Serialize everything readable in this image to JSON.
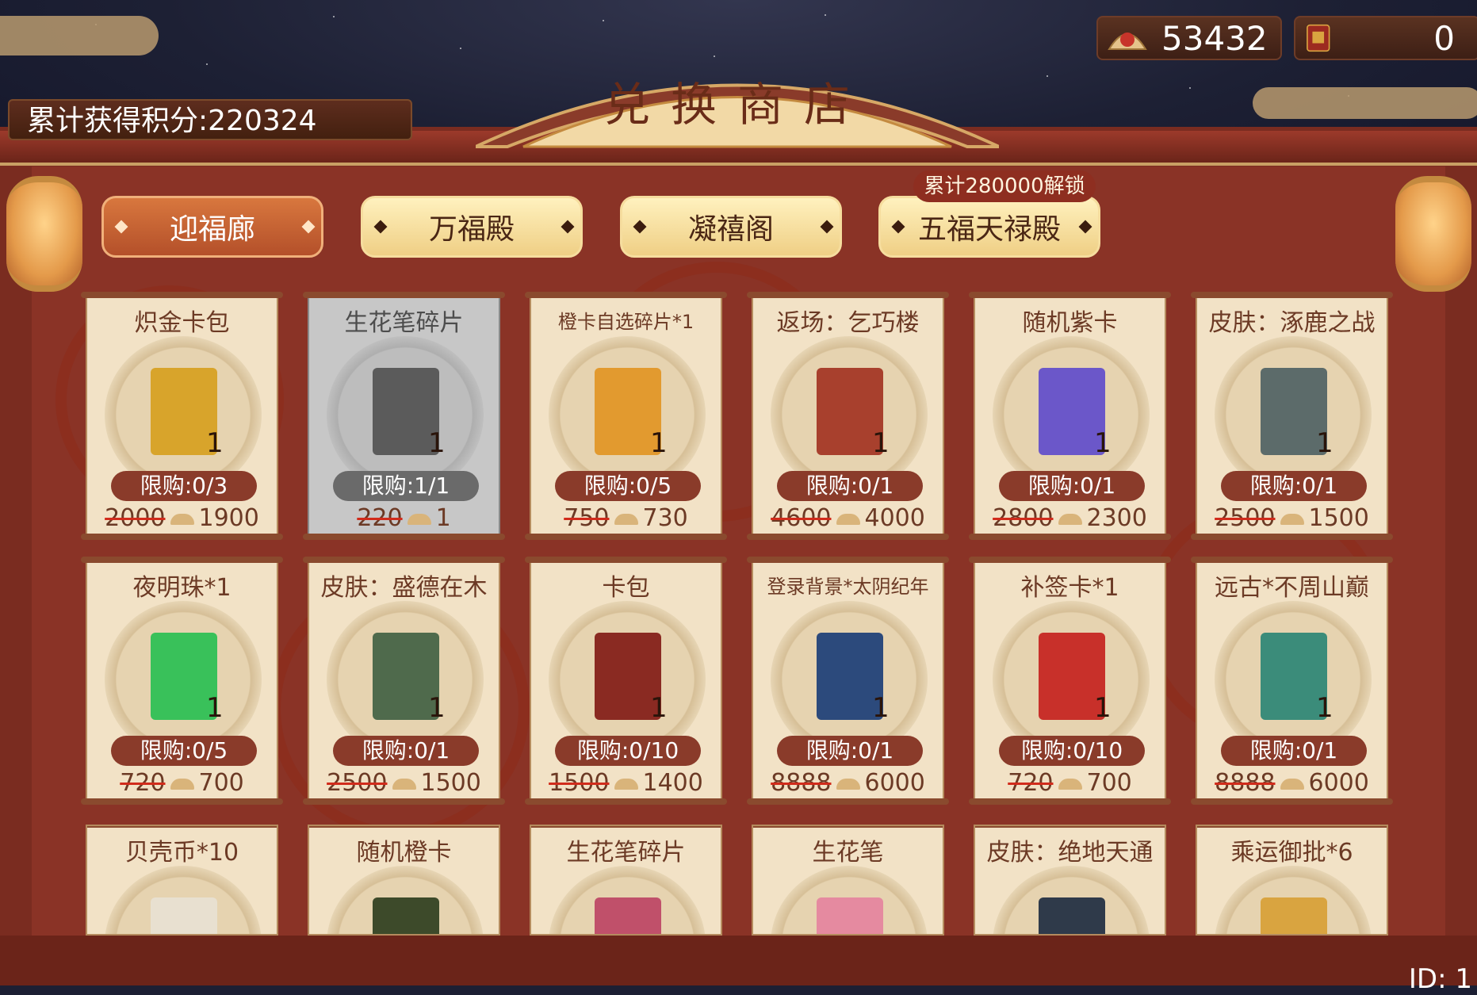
{
  "currency": {
    "points_icon": "points-coin-icon",
    "points": "53432",
    "exchange_icon": "exchange-token-icon",
    "tokens": "0"
  },
  "header": {
    "total_score": "累计获得积分:220324",
    "shop_title": "兑换商店"
  },
  "tabs": [
    {
      "label": "迎福廊",
      "active": true
    },
    {
      "label": "万福殿",
      "active": false
    },
    {
      "label": "凝禧阁",
      "active": false
    },
    {
      "label": "五福天禄殿",
      "active": false
    }
  ],
  "unlock_badge": "累计280000解锁",
  "items": [
    {
      "name": "炽金卡包",
      "qty": "1",
      "limit": "限购:0/3",
      "old_price": "2000",
      "price": "1900",
      "sold_out": false,
      "icon": "gold-card-pack-icon",
      "color": "#d8a42b"
    },
    {
      "name": "生花笔碎片",
      "qty": "1",
      "limit": "限购:1/1",
      "old_price": "220",
      "price": "1",
      "sold_out": true,
      "icon": "brush-fragment-icon",
      "color": "#5b5b5b"
    },
    {
      "name": "橙卡自选碎片*1",
      "qty": "1",
      "limit": "限购:0/5",
      "old_price": "750",
      "price": "730",
      "sold_out": false,
      "icon": "orange-fragment-icon",
      "color": "#e29a2f"
    },
    {
      "name": "返场：乞巧楼",
      "qty": "1",
      "limit": "限购:0/1",
      "old_price": "4600",
      "price": "4000",
      "sold_out": false,
      "icon": "qiqiao-tower-icon",
      "color": "#a8402d"
    },
    {
      "name": "随机紫卡",
      "qty": "1",
      "limit": "限购:0/1",
      "old_price": "2800",
      "price": "2300",
      "sold_out": false,
      "icon": "purple-card-icon",
      "color": "#6b57c9"
    },
    {
      "name": "皮肤：涿鹿之战",
      "qty": "1",
      "limit": "限购:0/1",
      "old_price": "2500",
      "price": "1500",
      "sold_out": false,
      "icon": "skin-zhuolu-icon",
      "color": "#5c6b6a"
    },
    {
      "name": "夜明珠*1",
      "qty": "1",
      "limit": "限购:0/5",
      "old_price": "720",
      "price": "700",
      "sold_out": false,
      "icon": "night-pearl-icon",
      "color": "#39c15a"
    },
    {
      "name": "皮肤：盛德在木",
      "qty": "1",
      "limit": "限购:0/1",
      "old_price": "2500",
      "price": "1500",
      "sold_out": false,
      "icon": "skin-shengde-icon",
      "color": "#4f6a4c"
    },
    {
      "name": "卡包",
      "qty": "1",
      "limit": "限购:0/10",
      "old_price": "1500",
      "price": "1400",
      "sold_out": false,
      "icon": "card-pack-icon",
      "color": "#8a2a22"
    },
    {
      "name": "登录背景*太阴纪年",
      "qty": "1",
      "limit": "限购:0/1",
      "old_price": "8888",
      "price": "6000",
      "sold_out": false,
      "icon": "login-bg-icon",
      "color": "#2c4a7c"
    },
    {
      "name": "补签卡*1",
      "qty": "1",
      "limit": "限购:0/10",
      "old_price": "720",
      "price": "700",
      "sold_out": false,
      "icon": "makeup-card-icon",
      "color": "#c8302a"
    },
    {
      "name": "远古*不周山巅",
      "qty": "1",
      "limit": "限购:0/1",
      "old_price": "8888",
      "price": "6000",
      "sold_out": false,
      "icon": "buzhou-peak-icon",
      "color": "#3b8c7a"
    },
    {
      "name": "贝壳币*10",
      "sold_out": false,
      "icon": "shell-coin-icon",
      "color": "#e8e0d0"
    },
    {
      "name": "随机橙卡",
      "sold_out": false,
      "icon": "orange-card-icon",
      "color": "#3d4a2a"
    },
    {
      "name": "生花笔碎片",
      "sold_out": false,
      "icon": "brush-fragment-icon",
      "color": "#c0506a"
    },
    {
      "name": "生花笔",
      "sold_out": false,
      "icon": "flower-brush-icon",
      "color": "#e58aa0"
    },
    {
      "name": "皮肤：绝地天通",
      "sold_out": false,
      "icon": "skin-juedi-icon",
      "color": "#2f3a4a"
    },
    {
      "name": "乘运御批*6",
      "sold_out": false,
      "icon": "imperial-scroll-icon",
      "color": "#d9a440"
    }
  ],
  "footer_id": "ID: 1"
}
